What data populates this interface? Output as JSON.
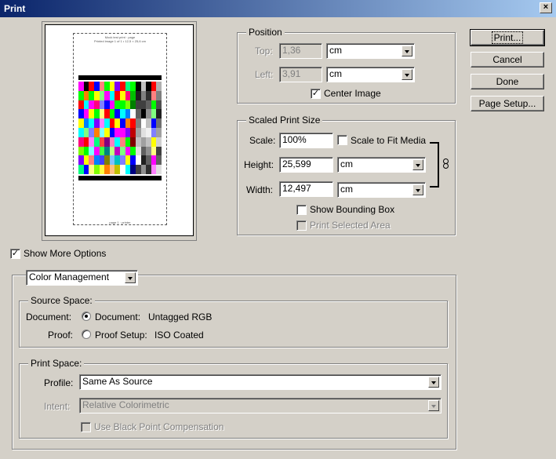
{
  "window": {
    "title": "Print",
    "close_glyph": "×"
  },
  "buttons": {
    "print": "Print...",
    "cancel": "Cancel",
    "done": "Done",
    "page_setup": "Page Setup..."
  },
  "position": {
    "legend": "Position",
    "top_label": "Top:",
    "top_value": "1,36",
    "top_unit": "cm",
    "left_label": "Left:",
    "left_value": "3,91",
    "left_unit": "cm",
    "center_label": "Center Image",
    "center_checked": true
  },
  "scaled": {
    "legend": "Scaled Print Size",
    "scale_label": "Scale:",
    "scale_value": "100%",
    "fit_label": "Scale to Fit Media",
    "fit_checked": false,
    "height_label": "Height:",
    "height_value": "25,599",
    "height_unit": "cm",
    "width_label": "Width:",
    "width_value": "12,497",
    "width_unit": "cm",
    "bbox_label": "Show Bounding Box",
    "bbox_checked": false,
    "selected_label": "Print Selected Area",
    "selected_checked": false
  },
  "more_options": {
    "label": "Show More Options",
    "checked": true
  },
  "options_dropdown": {
    "value": "Color Management"
  },
  "source_space": {
    "legend": "Source Space:",
    "document_label": "Document:",
    "document_option": "Document:",
    "document_value": "Untagged RGB",
    "proof_label": "Proof:",
    "proof_option": "Proof Setup:",
    "proof_value": "ISO Coated"
  },
  "print_space": {
    "legend": "Print Space:",
    "profile_label": "Profile:",
    "profile_value": "Same As Source",
    "intent_label": "Intent:",
    "intent_value": "Relative Colorimetric",
    "bpc_label": "Use Black Point Compensation",
    "bpc_checked": false
  },
  "preview": {
    "header_lines": [
      "Mock test print · page",
      "Printed image 1 of 1 • 12,5 × 25,6 cm"
    ],
    "footer_line": "page 1 · printer",
    "swatch_columns": [
      [
        "#ff00ff",
        "#00ff00",
        "#ff0000",
        "#0000ff",
        "#ffff00",
        "#00ffff",
        "#ff0080",
        "#80ff00",
        "#8000ff",
        "#00ff80"
      ],
      [
        "#000000",
        "#ff8000",
        "#00ffff",
        "#ff00ff",
        "#0080ff",
        "#80ff80",
        "#ff0000",
        "#00ff00",
        "#ffff00",
        "#0000ff"
      ],
      [
        "#ff0000",
        "#00ff00",
        "#ff00ff",
        "#ffff00",
        "#00ffff",
        "#8080ff",
        "#ff80ff",
        "#80ffff",
        "#ff8080",
        "#ffff80"
      ],
      [
        "#0000ff",
        "#ffff00",
        "#ff0080",
        "#00ff00",
        "#8000ff",
        "#ff8000",
        "#00ff80",
        "#ff00ff",
        "#0080ff",
        "#80ff00"
      ],
      [
        "#ff8080",
        "#80ff80",
        "#8080ff",
        "#ffff80",
        "#ff80ff",
        "#80ffff",
        "#ff4040",
        "#40ff40",
        "#4040ff",
        "#ffff40"
      ],
      [
        "#00ff00",
        "#ff00ff",
        "#0000ff",
        "#ff0000",
        "#00ffff",
        "#ffff00",
        "#800080",
        "#008080",
        "#808000",
        "#ff8000"
      ],
      [
        "#ffff00",
        "#00ffff",
        "#ff00ff",
        "#00ff00",
        "#ff0000",
        "#0000ff",
        "#ff80c0",
        "#c0ff80",
        "#80c0ff",
        "#ffc080"
      ],
      [
        "#8000ff",
        "#ff0000",
        "#00ff00",
        "#0000ff",
        "#ffff00",
        "#ff00ff",
        "#00ffff",
        "#c000c0",
        "#00c0c0",
        "#c0c000"
      ],
      [
        "#ff0000",
        "#ffff00",
        "#00ff00",
        "#00ffff",
        "#0000ff",
        "#ff00ff",
        "#ff8080",
        "#80ff80",
        "#8080ff",
        "#ffffff"
      ],
      [
        "#00ff80",
        "#ff0080",
        "#80ff00",
        "#0080ff",
        "#ff8000",
        "#8000ff",
        "#00ff00",
        "#ff00ff",
        "#ffff00",
        "#00ffff"
      ],
      [
        "#00ff00",
        "#00c000",
        "#008000",
        "#ffffff",
        "#ff0000",
        "#c00000",
        "#800000",
        "#00ff00",
        "#0000ff",
        "#000080"
      ],
      [
        "#000000",
        "#202020",
        "#404040",
        "#606060",
        "#808080",
        "#a0a0a0",
        "#c0c0c0",
        "#e0e0e0",
        "#ffffff",
        "#404040"
      ],
      [
        "#c0c0c0",
        "#808080",
        "#404040",
        "#000000",
        "#ffffff",
        "#e0e0e0",
        "#a0a0a0",
        "#606060",
        "#202020",
        "#909090"
      ],
      [
        "#000000",
        "#303030",
        "#606060",
        "#909090",
        "#c0c0c0",
        "#f0f0f0",
        "#c0c0c0",
        "#909090",
        "#606060",
        "#303030"
      ],
      [
        "#ff0000",
        "#ff8080",
        "#00ff00",
        "#80ff80",
        "#0000ff",
        "#8080ff",
        "#ffff00",
        "#ffff80",
        "#ff00ff",
        "#ff80ff"
      ],
      [
        "#b0b0b0",
        "#808080",
        "#505050",
        "#202020",
        "#707070",
        "#a0a0a0",
        "#d0d0d0",
        "#404040",
        "#606060",
        "#e0e0e0"
      ]
    ]
  }
}
